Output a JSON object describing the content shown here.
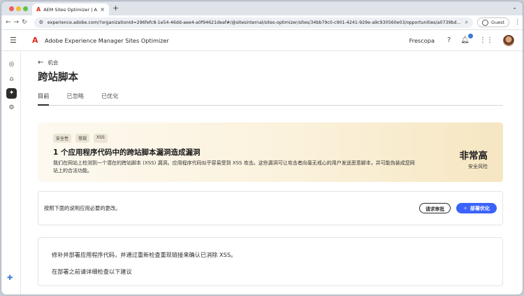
{
  "browser": {
    "tab_title": "AEM Sites Optimizer | Adobe",
    "favicon_text": "A",
    "close_glyph": "×",
    "newtab_glyph": "+",
    "chevron_glyph": "⌄",
    "url": "experience.adobe.com/?organizationId=296fefc8-1e54-46dd-aee4-a0f94621deaf#/@sitesinternal/sites-optimizer/sites/34bb79c0-c901-4241-929e-a9c930560e03/opportunities/a0739bd...",
    "guest_label": "Guest"
  },
  "header": {
    "app_name": "Adobe Experience Manager Sites Optimizer",
    "org_name": "Frescopa"
  },
  "page": {
    "back_label": "机会",
    "title": "跨站脚本",
    "tabs": [
      {
        "label": "目前",
        "active": true
      },
      {
        "label": "已忽略",
        "active": false
      },
      {
        "label": "已优化",
        "active": false
      }
    ]
  },
  "hero": {
    "chips": [
      "安全性",
      "常规",
      "XSS"
    ],
    "title": "1 个应用程序代码中的跨站脚本漏洞造成漏洞",
    "description": "我们在网站上检测到一个潜在的跨站脚本 (XSS) 漏洞。应用程序代码似乎容易受到 XSS 攻击。这些漏洞可让攻击者向毫无戒心的用户发送恶意脚本，并可能伪装成您网站上的合法功能。",
    "severity_level": "非常高",
    "severity_label": "安全风险"
  },
  "action": {
    "instruction": "按照下面的说明应用必要的更改。",
    "request_review_label": "请求审批",
    "deploy_label": "部署优化"
  },
  "details": {
    "line1": "修补并部署应用程序代码，并通过重新检查重现链接来确认已消除 XSS。",
    "line2": "在部署之前请详细检查以下建议"
  },
  "colors": {
    "accent": "#3b63fb",
    "adobe_red": "#e0261b"
  }
}
